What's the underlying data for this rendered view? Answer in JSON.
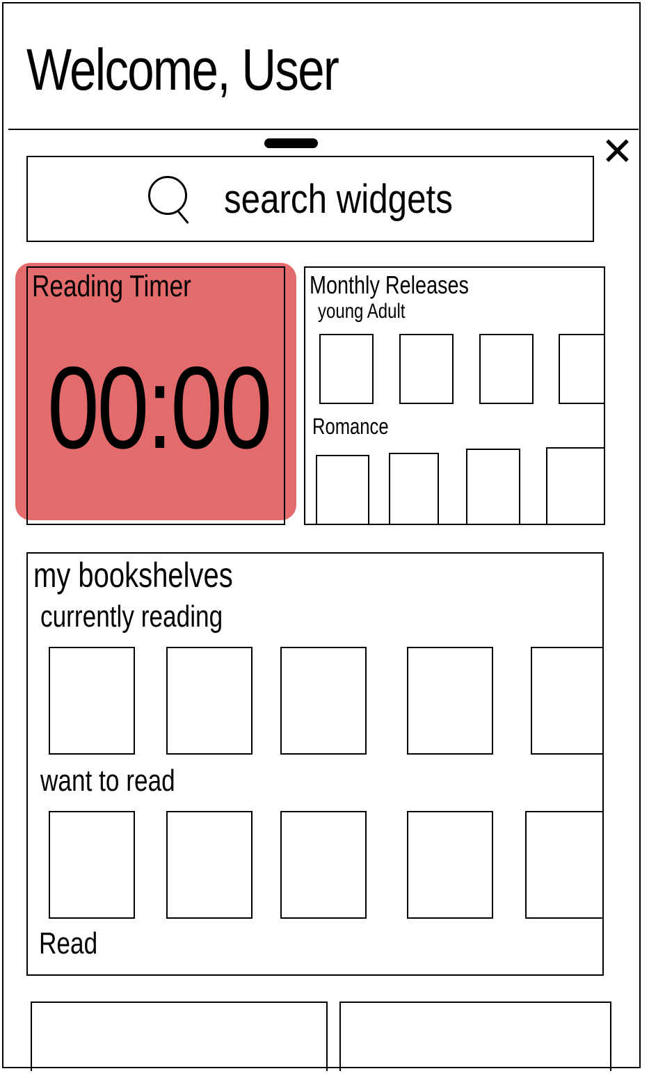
{
  "header": {
    "title": "Welcome, User"
  },
  "panel": {
    "close_icon": "close-x-icon",
    "handle_icon": "drag-handle-icon",
    "search": {
      "icon": "search-icon",
      "placeholder": "search widgets"
    }
  },
  "widgets": {
    "reading_timer": {
      "label": "Reading Timer",
      "time": "00:00",
      "color": "#e36b6b"
    },
    "monthly_releases": {
      "title": "Monthly Releases",
      "sections": [
        {
          "label": "young Adult",
          "books": 4
        },
        {
          "label": "Romance",
          "books": 4
        }
      ]
    },
    "bookshelves": {
      "title": "my bookshelves",
      "shelves": [
        {
          "label": "currently reading",
          "books": 5
        },
        {
          "label": "want to read",
          "books": 5
        },
        {
          "label": "Read",
          "books": 0
        }
      ]
    }
  },
  "bottom_nav": {
    "buttons": [
      "",
      ""
    ]
  }
}
